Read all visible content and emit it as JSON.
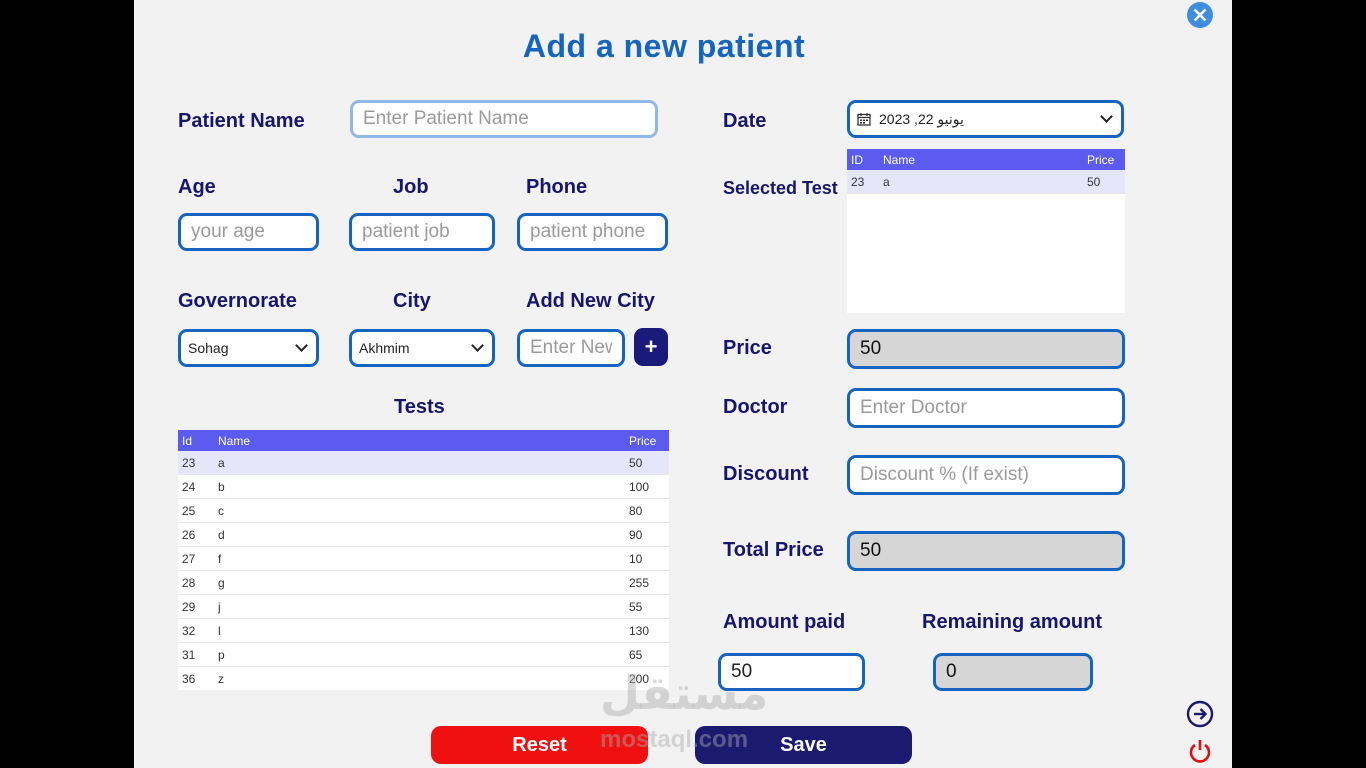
{
  "title": "Add a new patient",
  "labels": {
    "patient_name": "Patient Name",
    "age": "Age",
    "job": "Job",
    "phone": "Phone",
    "governorate": "Governorate",
    "city": "City",
    "add_new_city": "Add New City",
    "tests": "Tests",
    "date": "Date",
    "selected_test": "Selected Test",
    "price": "Price",
    "doctor": "Doctor",
    "discount": "Discount",
    "total_price": "Total Price",
    "amount_paid": "Amount paid",
    "remaining_amount": "Remaining amount"
  },
  "inputs": {
    "patient_name_placeholder": "Enter Patient Name",
    "age_placeholder": "your age",
    "job_placeholder": "patient job",
    "phone_placeholder": "patient phone",
    "new_city_placeholder": "Enter New City",
    "price_value": "50",
    "doctor_placeholder": "Enter Doctor",
    "discount_placeholder": "Discount % (If exist)",
    "total_price_value": "50",
    "amount_paid_value": "50",
    "remaining_amount_value": "0"
  },
  "selects": {
    "governorate": "Sohag",
    "city": "Akhmim",
    "date": "يونيو 22, 2023"
  },
  "add_city_button": "+",
  "tests_table": {
    "headers": [
      "Id",
      "Name",
      "Price"
    ],
    "rows": [
      [
        "23",
        "a",
        "50"
      ],
      [
        "24",
        "b",
        "100"
      ],
      [
        "25",
        "c",
        "80"
      ],
      [
        "26",
        "d",
        "90"
      ],
      [
        "27",
        "f",
        "10"
      ],
      [
        "28",
        "g",
        "255"
      ],
      [
        "29",
        "j",
        "55"
      ],
      [
        "32",
        "l",
        "130"
      ],
      [
        "31",
        "p",
        "65"
      ],
      [
        "36",
        "z",
        "200"
      ]
    ]
  },
  "selected_table": {
    "headers": [
      "ID",
      "Name",
      "Price"
    ],
    "rows": [
      [
        "23",
        "a",
        "50"
      ]
    ]
  },
  "buttons": {
    "reset": "Reset",
    "save": "Save"
  },
  "icons": {
    "close": "close-icon",
    "calendar": "calendar-icon",
    "next": "arrow-right-icon",
    "power": "power-icon"
  },
  "watermark": {
    "arabic": "مستقل",
    "latin": "mostaql.com"
  },
  "colors": {
    "accent": "#1565c0",
    "label": "#16166b",
    "grid_header": "#5b5bf0",
    "reset": "#f01010",
    "save": "#1a1a6e"
  }
}
